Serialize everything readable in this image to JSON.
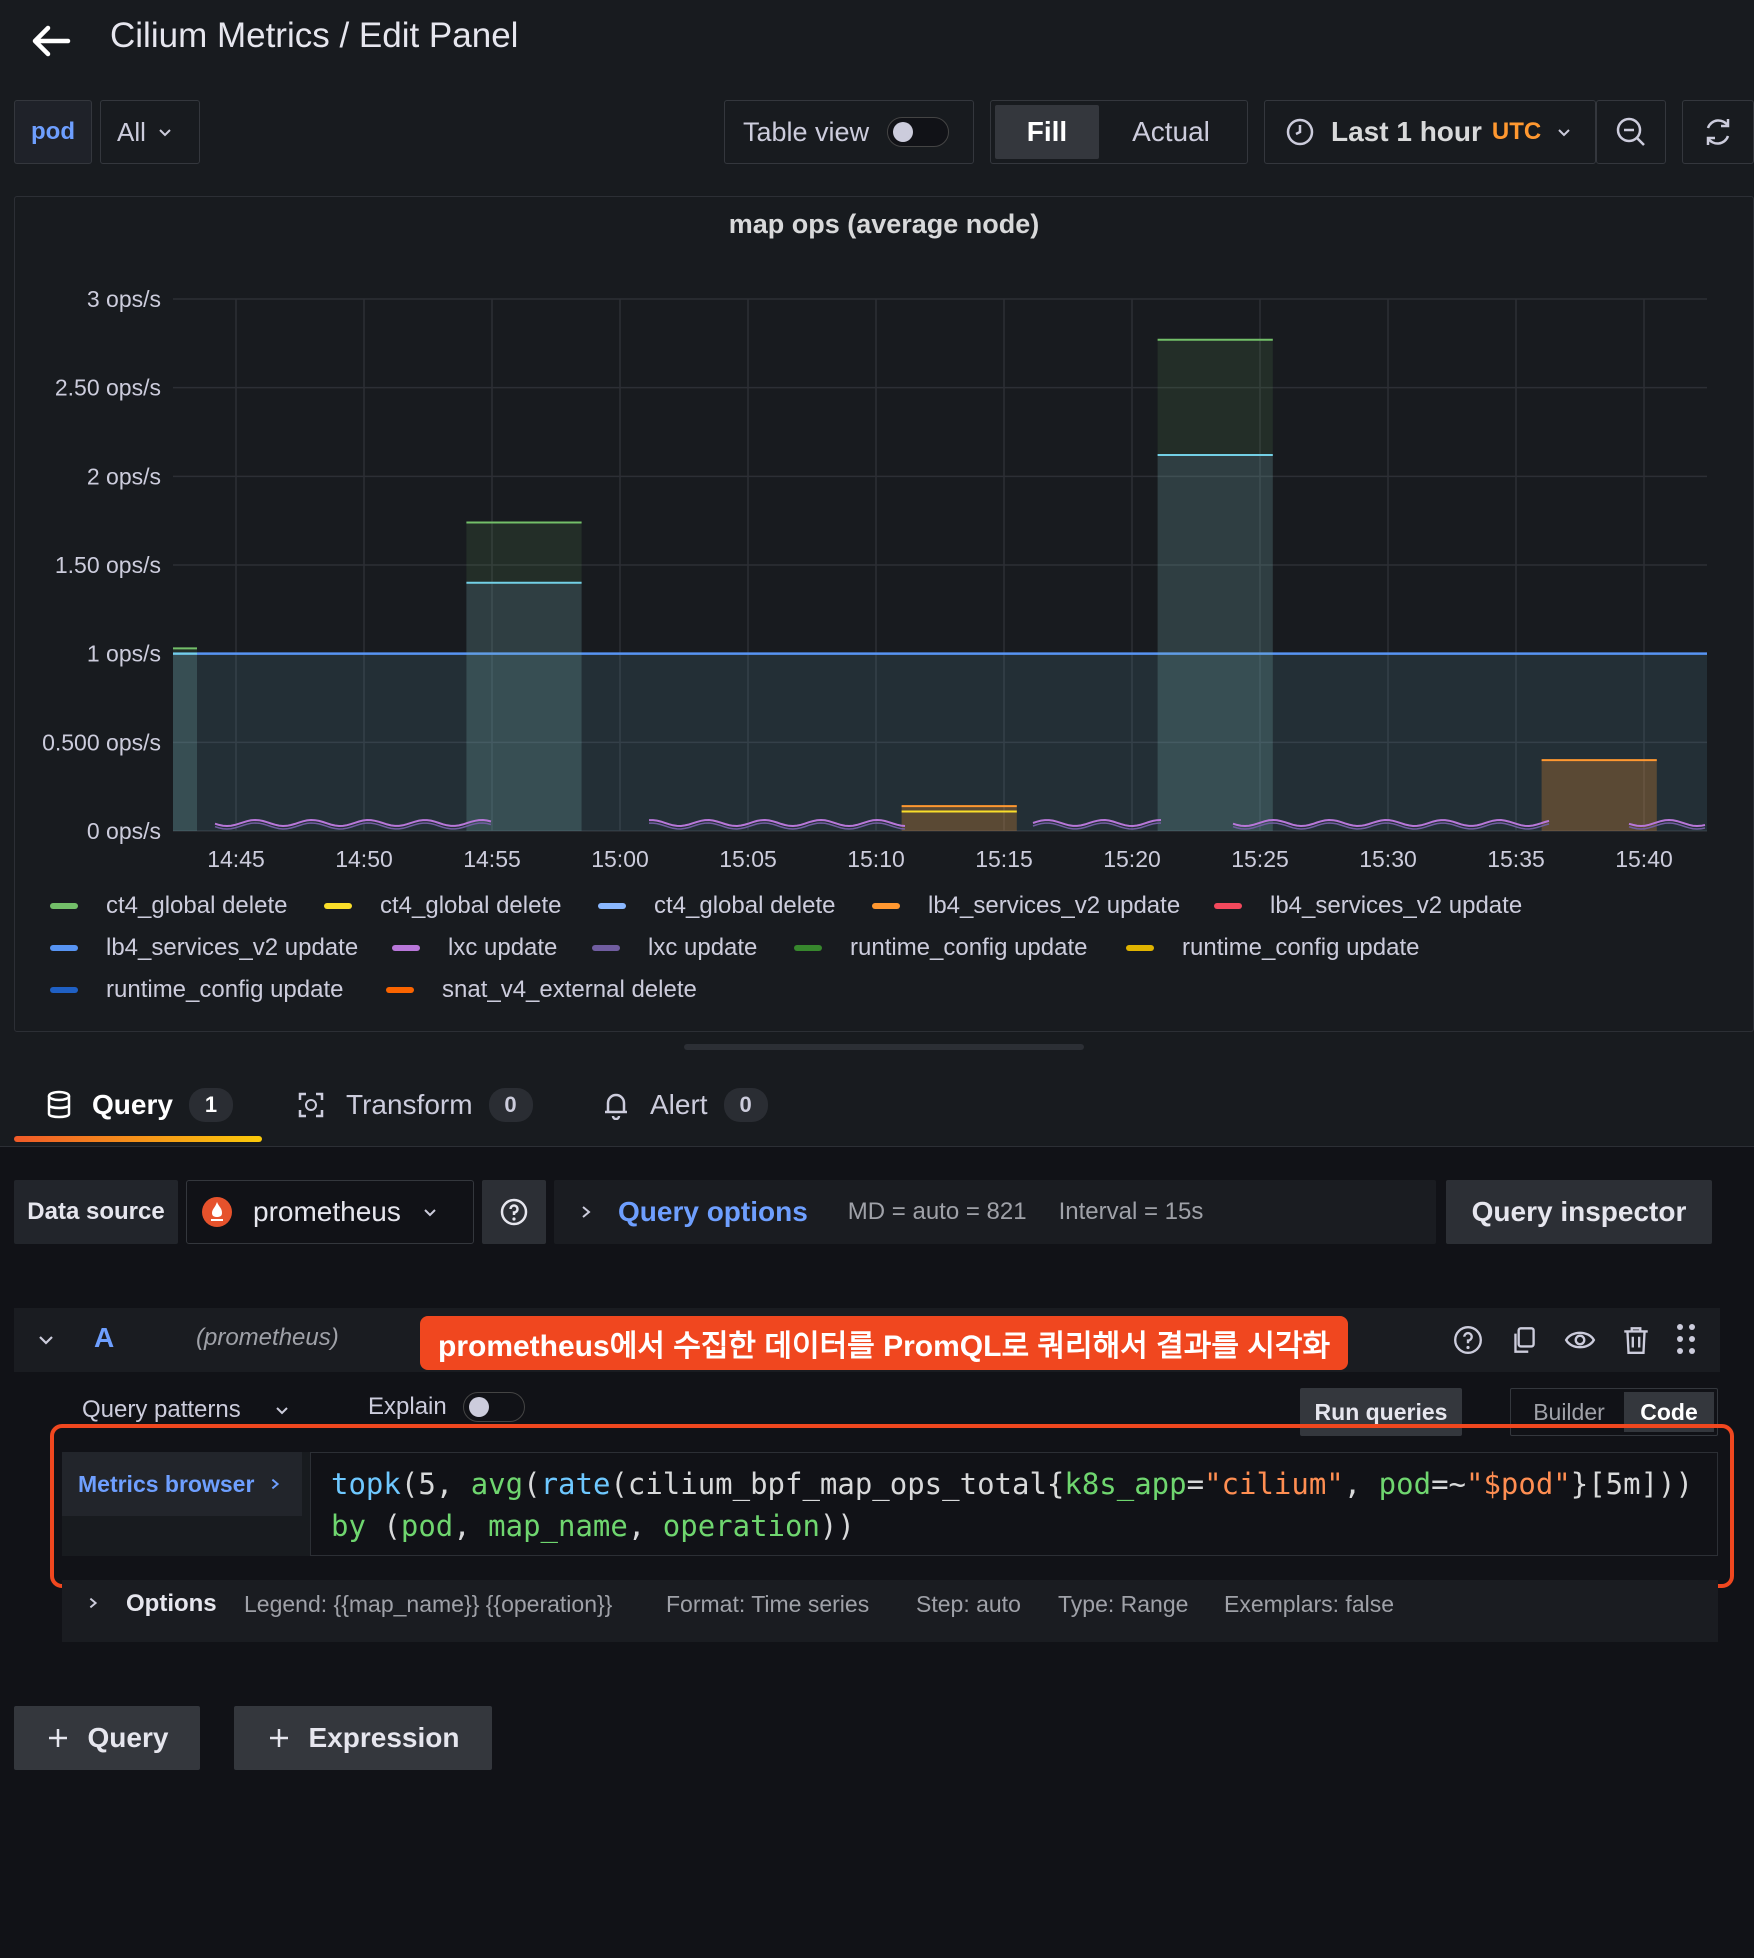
{
  "header": {
    "title": "Cilium Metrics / Edit Panel"
  },
  "toolbar": {
    "var_name": "pod",
    "var_value": "All",
    "table_view_label": "Table view",
    "fill_label": "Fill",
    "actual_label": "Actual",
    "time_range_label": "Last 1 hour",
    "timezone_label": "UTC"
  },
  "chart_data": {
    "type": "bar",
    "title": "map ops (average node)",
    "y_ticks": [
      "0 ops/s",
      "0.500 ops/s",
      "1 ops/s",
      "1.50 ops/s",
      "2 ops/s",
      "2.50 ops/s",
      "3 ops/s"
    ],
    "ylim": [
      0,
      3
    ],
    "x_ticks": [
      "14:45",
      "14:50",
      "14:55",
      "15:00",
      "15:05",
      "15:10",
      "15:15",
      "15:20",
      "15:25",
      "15:30",
      "15:35",
      "15:40"
    ],
    "grid": true,
    "legend_placement": "bottom",
    "baseline_series": {
      "name": "lb4_services_v2 update",
      "value": 1
    },
    "series": [
      {
        "name": "ct4_global delete",
        "color": "#73bf69"
      },
      {
        "name": "ct4_global delete",
        "color": "#fade2a"
      },
      {
        "name": "ct4_global delete",
        "color": "#8ab8ff"
      },
      {
        "name": "lb4_services_v2 update",
        "color": "#ff9830"
      },
      {
        "name": "lb4_services_v2 update",
        "color": "#f2495c"
      },
      {
        "name": "lb4_services_v2 update",
        "color": "#5794f2"
      },
      {
        "name": "lxc update",
        "color": "#b877d9"
      },
      {
        "name": "lxc update",
        "color": "#705da0"
      },
      {
        "name": "runtime_config update",
        "color": "#37872d"
      },
      {
        "name": "runtime_config update",
        "color": "#e0b400"
      },
      {
        "name": "runtime_config update",
        "color": "#1f60c4"
      },
      {
        "name": "snat_v4_external delete",
        "color": "#fa6400"
      }
    ],
    "bars": [
      {
        "start": "14:42",
        "end": "14:43",
        "green": 1.03,
        "cyan": 1.0
      },
      {
        "start": "14:54",
        "end": "14:58.5",
        "green": 1.74,
        "cyan": 1.4
      },
      {
        "start": "15:11",
        "end": "15:15.5",
        "orange": 0.14,
        "yellow": 0.11
      },
      {
        "start": "15:21",
        "end": "15:25.5",
        "green": 2.77,
        "cyan": 2.12
      },
      {
        "start": "15:36",
        "end": "15:40.5",
        "orange": 0.4
      }
    ]
  },
  "tabs": [
    {
      "label": "Query",
      "count": "1"
    },
    {
      "label": "Transform",
      "count": "0"
    },
    {
      "label": "Alert",
      "count": "0"
    }
  ],
  "datasource": {
    "label": "Data source",
    "value": "prometheus",
    "query_options_label": "Query options",
    "md_text": "MD = auto = 821",
    "interval_text": "Interval = 15s",
    "query_inspector_label": "Query inspector"
  },
  "query_row": {
    "ref_id": "A",
    "ds_name": "(prometheus)",
    "annotation": "prometheus에서 수집한 데이터를 PromQL로 쿼리해서 결과를 시각화",
    "query_patterns_label": "Query patterns",
    "explain_label": "Explain",
    "run_queries_label": "Run queries",
    "builder_label": "Builder",
    "code_label": "Code",
    "metrics_browser_label": "Metrics browser",
    "options_label": "Options",
    "legend_text": "Legend: {{map_name}} {{operation}}",
    "format_text": "Format: Time series",
    "step_text": "Step: auto",
    "type_text": "Type: Range",
    "exemplars_text": "Exemplars: false"
  },
  "query_code": {
    "line1": [
      {
        "t": "topk",
        "c": "#6ec8ff"
      },
      {
        "t": "(",
        "c": "#d8d9da"
      },
      {
        "t": "5",
        "c": "#d8d9da"
      },
      {
        "t": ", ",
        "c": "#d8d9da"
      },
      {
        "t": "avg",
        "c": "#6fd66f"
      },
      {
        "t": "(",
        "c": "#d8d9da"
      },
      {
        "t": "rate",
        "c": "#6ec8ff"
      },
      {
        "t": "(",
        "c": "#d8d9da"
      },
      {
        "t": "cilium_bpf_map_ops_total",
        "c": "#d8d9da"
      },
      {
        "t": "{",
        "c": "#d8d9da"
      },
      {
        "t": "k8s_app",
        "c": "#6fd66f"
      },
      {
        "t": "=",
        "c": "#d8d9da"
      },
      {
        "t": "\"cilium\"",
        "c": "#ff8e52"
      },
      {
        "t": ", ",
        "c": "#d8d9da"
      },
      {
        "t": "pod",
        "c": "#6fd66f"
      },
      {
        "t": "=~",
        "c": "#d8d9da"
      },
      {
        "t": "\"$pod\"",
        "c": "#ff8e52"
      },
      {
        "t": "}[5m]))",
        "c": "#d8d9da"
      }
    ],
    "line2": [
      {
        "t": "by ",
        "c": "#6fd66f"
      },
      {
        "t": "(",
        "c": "#d8d9da"
      },
      {
        "t": "pod",
        "c": "#6fd66f"
      },
      {
        "t": ", ",
        "c": "#d8d9da"
      },
      {
        "t": "map_name",
        "c": "#6fd66f"
      },
      {
        "t": ", ",
        "c": "#d8d9da"
      },
      {
        "t": "operation",
        "c": "#6fd66f"
      },
      {
        "t": "))",
        "c": "#d8d9da"
      }
    ]
  },
  "add_buttons": {
    "query_label": "Query",
    "expression_label": "Expression"
  }
}
